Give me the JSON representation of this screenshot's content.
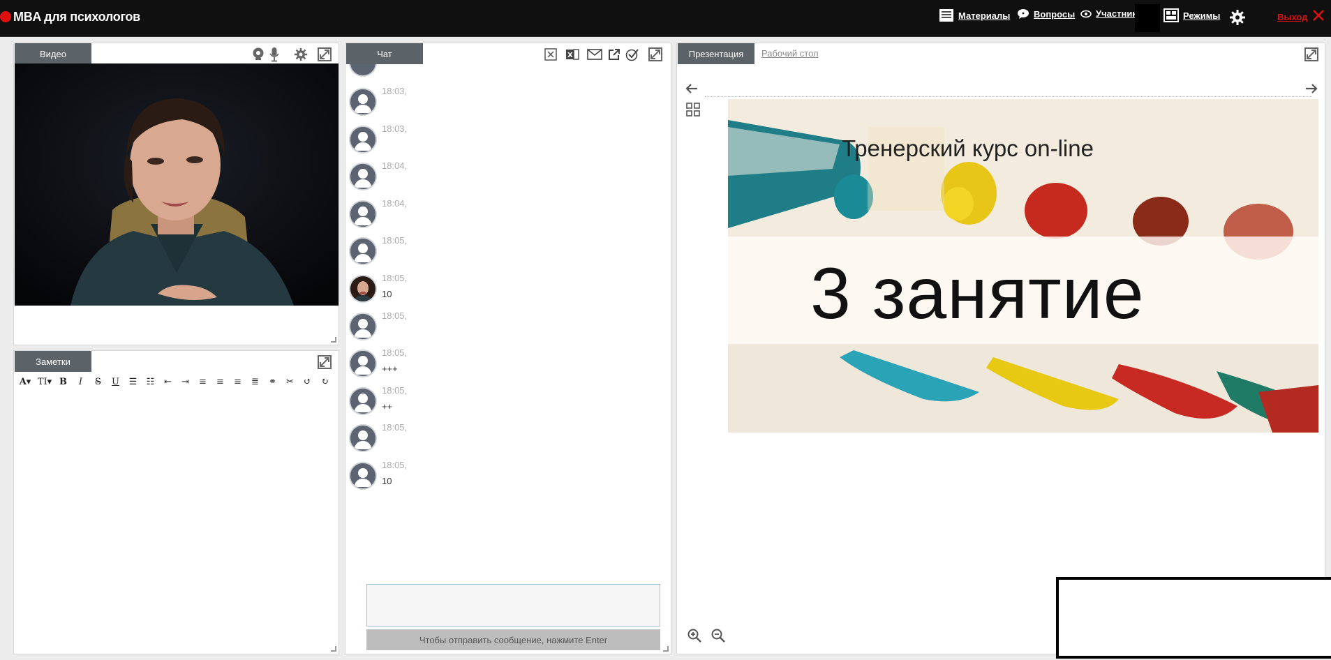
{
  "app": {
    "title": "MBA для психологов"
  },
  "nav": {
    "materials": "Материалы",
    "questions": "Вопросы",
    "participants": "Участники",
    "modes": "Режимы",
    "exit": "Выход"
  },
  "video_panel": {
    "tab": "Видео"
  },
  "notes_panel": {
    "tab": "Заметки"
  },
  "chat_panel": {
    "tab": "Чат",
    "messages": [
      {
        "time": "18:03,",
        "text": ""
      },
      {
        "time": "18:03,",
        "text": ""
      },
      {
        "time": "18:04,",
        "text": ""
      },
      {
        "time": "18:04,",
        "text": ""
      },
      {
        "time": "18:05,",
        "text": ""
      },
      {
        "time": "18:05,",
        "text": "10"
      },
      {
        "time": "18:05,",
        "text": ""
      },
      {
        "time": "18:05,",
        "text": "+++"
      },
      {
        "time": "18:05,",
        "text": "++"
      },
      {
        "time": "18:05,",
        "text": ""
      },
      {
        "time": "18:05,",
        "text": "10"
      }
    ],
    "send_hint": "Чтобы отправить сообщение, нажмите Enter"
  },
  "presentation_panel": {
    "tab": "Презентация",
    "desktop_link": "Рабочий стол",
    "slide": {
      "subtitle": "Тренерский курс on-line",
      "title": "3 занятие"
    }
  },
  "colors": {
    "topbar": "#101010",
    "tab": "#5b6268",
    "accent": "#e01010"
  }
}
